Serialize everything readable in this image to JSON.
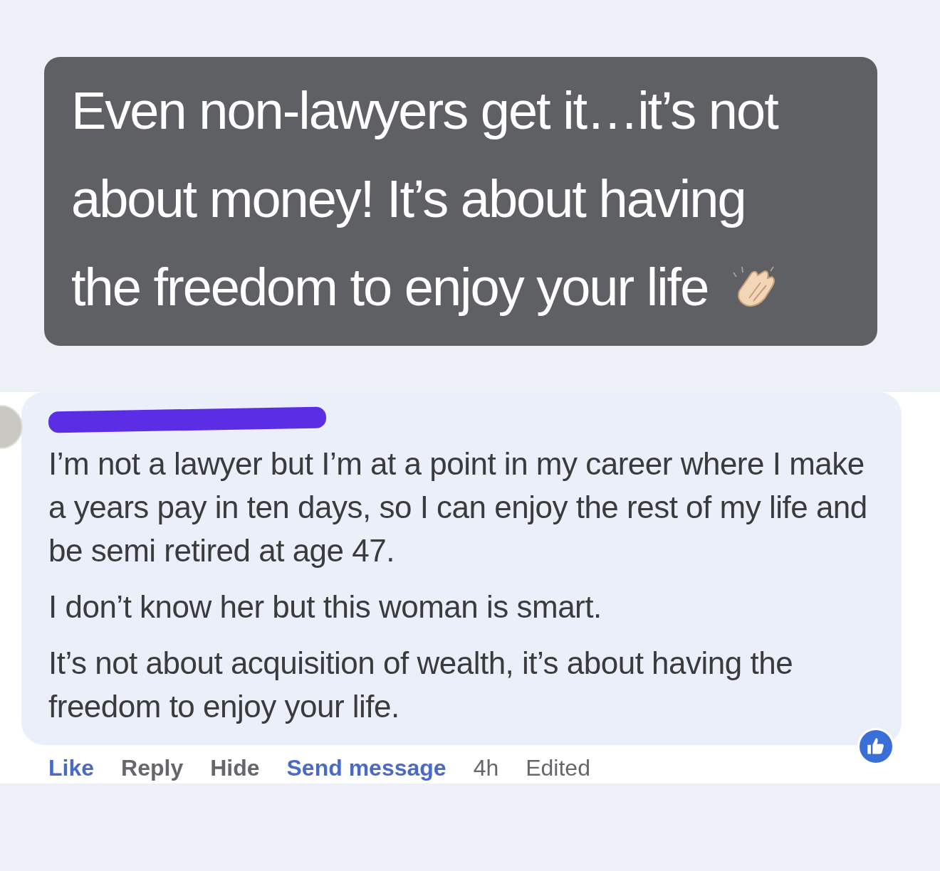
{
  "caption": {
    "lines": [
      "Even non-lawyers get it…it’s not",
      "about money! It’s about having",
      "the freedom to enjoy your life"
    ]
  },
  "comment": {
    "paragraphs": [
      "I’m not a lawyer but I’m at a point in my career where I make a years pay in ten days, so I can enjoy the rest of my life and be semi retired at age 47.",
      "I don’t know her but this woman is smart.",
      "It’s not about acquisition of wealth, it’s about having the freedom to enjoy your life."
    ],
    "actions": [
      {
        "label": "Like",
        "kind": "link"
      },
      {
        "label": "Reply",
        "kind": "action"
      },
      {
        "label": "Hide",
        "kind": "action"
      },
      {
        "label": "Send message",
        "kind": "link"
      },
      {
        "label": "4h",
        "kind": "meta"
      },
      {
        "label": "Edited",
        "kind": "meta"
      }
    ]
  }
}
